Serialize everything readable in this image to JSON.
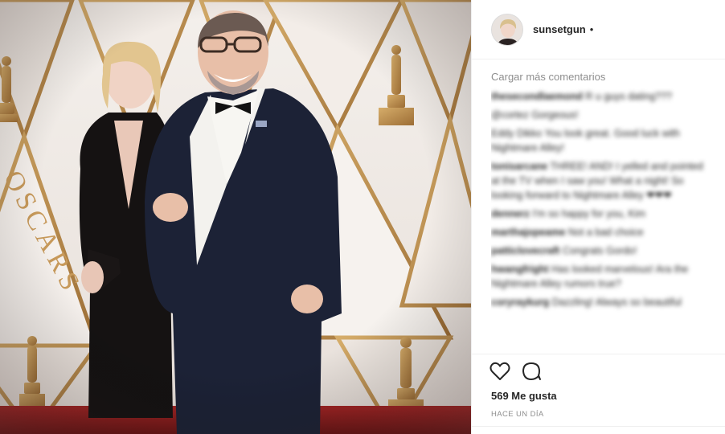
{
  "post": {
    "username": "sunsetgun",
    "follow_dot": "•",
    "load_more": "Cargar más comentarios",
    "likes": "569 Me gusta",
    "time": "HACE UN DÍA",
    "photo_sign_text": "OSCARS"
  },
  "comments": [
    {
      "user": "thesecondlaemond",
      "text": "R u guys dating???"
    },
    {
      "user": "",
      "text": "@cortez Gorgeous!"
    },
    {
      "user": "",
      "text": "Eddy Dikko You look great. Good luck with Nightmare Alley!"
    },
    {
      "user": "tonisarcane",
      "text": "THREE! AND! I yelled and pointed at the TV when I saw you! What a night! So looking forward to Nightmare Alley ❤❤❤"
    },
    {
      "user": "dennerz",
      "text": "I'm so happy for you, Kim"
    },
    {
      "user": "marthajopeame",
      "text": "Not a bad choice"
    },
    {
      "user": "patticlovecraft",
      "text": "Congrats Gordo!"
    },
    {
      "user": "hwangfright",
      "text": "Has looked marvelous! Ara the Nightmare Alley rumors true?"
    },
    {
      "user": "coryraykurg",
      "text": "Dazzling! Always so beautiful"
    }
  ],
  "icons": {
    "like": "heart-icon",
    "comment": "comment-icon"
  },
  "colors": {
    "carpet": "#8e1d1d",
    "gold": "#c69a5a",
    "panel": "#f3eeea"
  }
}
